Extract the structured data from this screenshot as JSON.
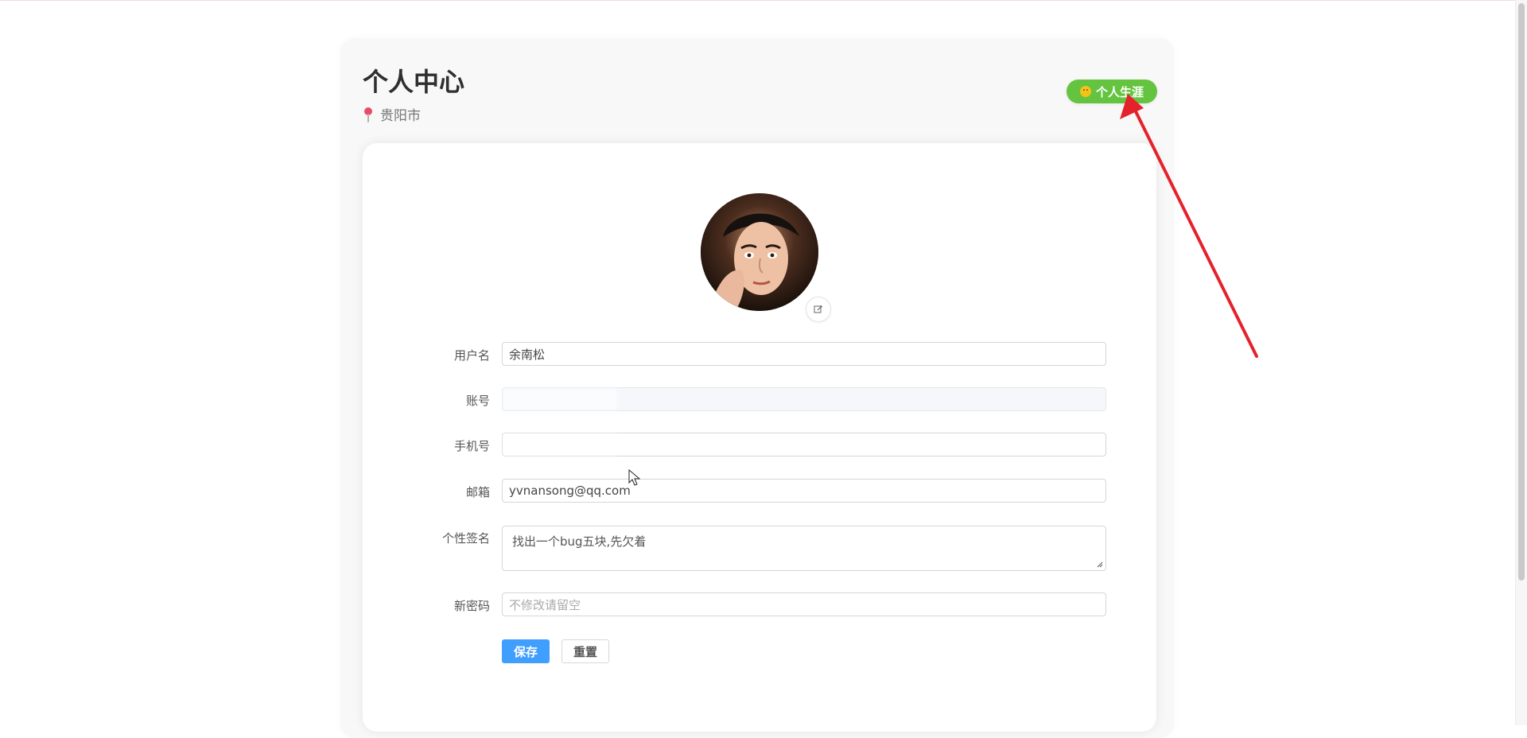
{
  "header": {
    "title": "个人中心",
    "location": "贵阳市",
    "career_badge": "个人生涯"
  },
  "icons": {
    "location": "location-pin-icon",
    "career": "smiley-emoji-icon",
    "avatar_edit": "edit-icon"
  },
  "form": {
    "username_label": "用户名",
    "username_value": "余南松",
    "account_label": "账号",
    "account_value": "",
    "phone_label": "手机号",
    "phone_value": "",
    "email_label": "邮箱",
    "email_value": "yvnansong@qq.com",
    "signature_label": "个性签名",
    "signature_value": "找出一个bug五块,先欠着",
    "password_label": "新密码",
    "password_placeholder": "不修改请留空"
  },
  "buttons": {
    "save": "保存",
    "reset": "重置"
  },
  "colors": {
    "accent_blue": "#409eff",
    "badge_green": "#64c43f",
    "annotation_red": "#e5222c"
  }
}
